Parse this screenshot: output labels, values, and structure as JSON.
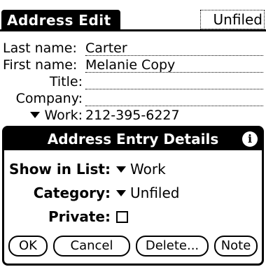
{
  "title": {
    "app_title": "Address Edit",
    "category": "Unfiled"
  },
  "form": {
    "last_name_label": "Last name:",
    "last_name_value": "Carter",
    "first_name_label": "First name:",
    "first_name_value": "Melanie Copy",
    "title_label": "Title:",
    "title_value": "",
    "company_label": "Company:",
    "company_value": "",
    "work_label": "Work:",
    "work_value": "212-395-6227"
  },
  "dialog": {
    "title": "Address Entry Details",
    "show_in_list_label": "Show in List:",
    "show_in_list_value": "Work",
    "category_label": "Category:",
    "category_value": "Unfiled",
    "private_label": "Private:",
    "private_checked": false,
    "buttons": {
      "ok": "OK",
      "cancel": "Cancel",
      "delete": "Delete...",
      "note": "Note"
    }
  }
}
